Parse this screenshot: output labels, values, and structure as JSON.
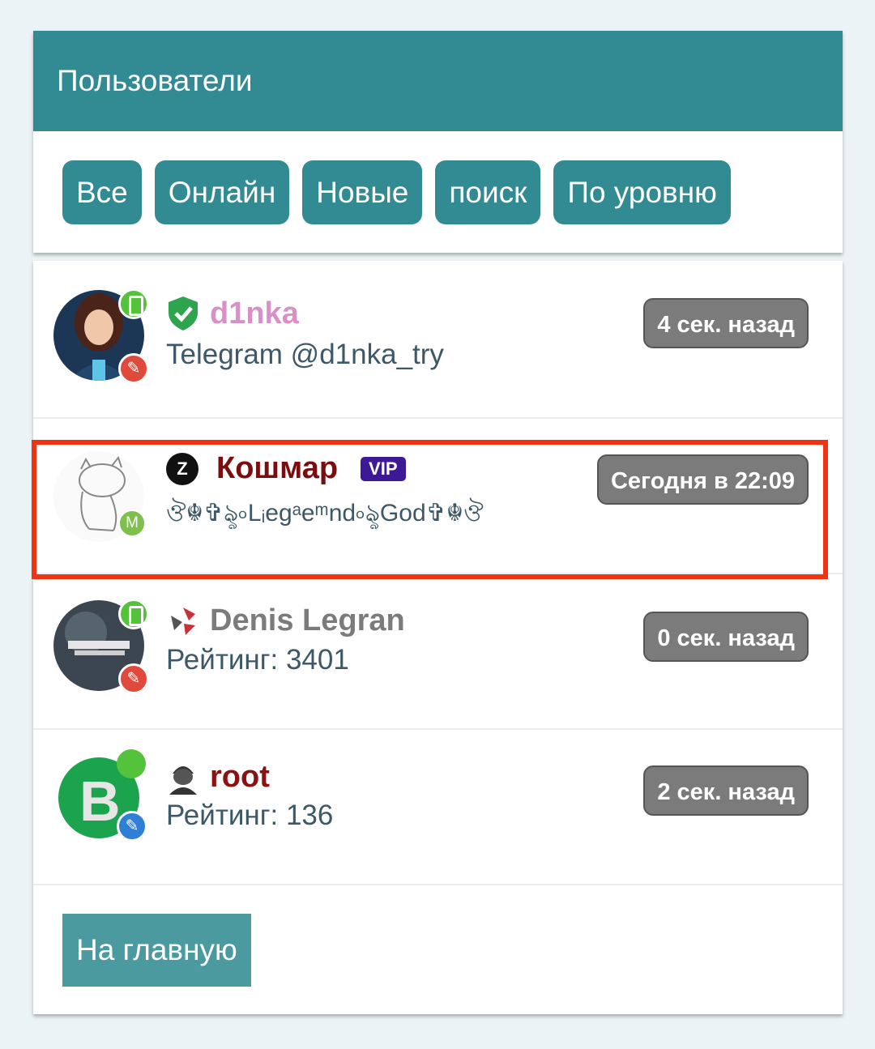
{
  "header": {
    "title": "Пользователи"
  },
  "tabs": [
    {
      "label": "Все"
    },
    {
      "label": "Онлайн"
    },
    {
      "label": "Новые"
    },
    {
      "label": "поиск"
    },
    {
      "label": "По уровню"
    }
  ],
  "users": [
    {
      "name": "d1nka",
      "subtitle": "Telegram @d1nka_try",
      "time": "4 сек. назад",
      "name_color": "#d98fc7"
    },
    {
      "name": "Кошмар",
      "badge": "VIP",
      "status_icon": "Z",
      "subtitle": "ঔ☬✞ৡ৹Lᵢegᵃeᵐnd৹ৡGod✞☬ঔ",
      "time": "Сегодня в 22:09",
      "name_color": "#7a0e0e"
    },
    {
      "name": "Denis Legran",
      "subtitle": "Рейтинг: 3401",
      "time": "0 сек. назад",
      "name_color": "#7b7b7b"
    },
    {
      "name": "root",
      "subtitle": "Рейтинг: 136",
      "time": "2 сек. назад",
      "name_color": "#8b1212"
    }
  ],
  "footer": {
    "home_label": "На главную"
  }
}
